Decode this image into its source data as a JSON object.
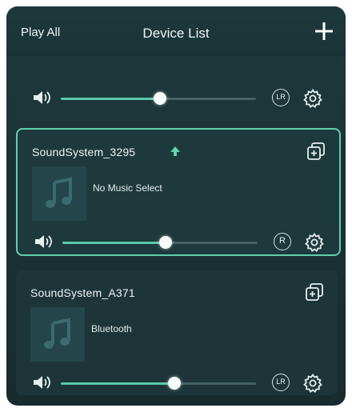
{
  "header": {
    "left_label": "Play All",
    "title": "Device List",
    "add_icon": "plus-icon"
  },
  "devices": [
    {
      "name": "",
      "source": "",
      "volume_percent": 51,
      "channel": "LR",
      "selected": false
    },
    {
      "name": "SoundSystem_3295",
      "source": "No Music Select",
      "volume_percent": 53,
      "channel": "R",
      "selected": true,
      "upgrade_icon": "upload-arrow-icon"
    },
    {
      "name": "SoundSystem_A371",
      "source": "Bluetooth",
      "volume_percent": 58,
      "channel": "LR",
      "selected": false
    }
  ],
  "colors": {
    "accent": "#59c9a9",
    "selected_border": "#5fcfae",
    "background": "#1b3234"
  }
}
